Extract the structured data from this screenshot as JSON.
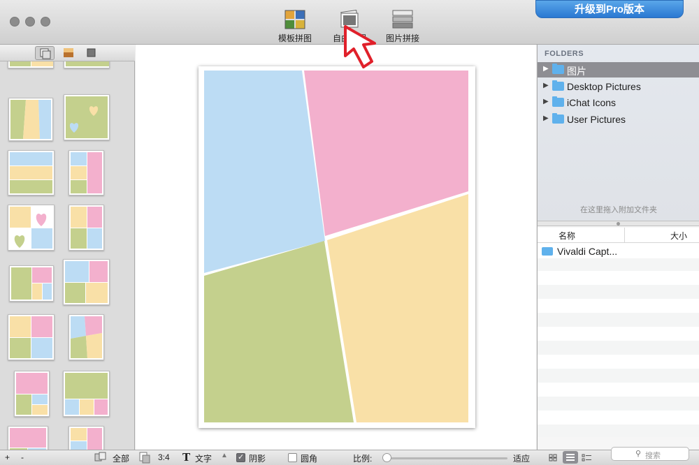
{
  "toolbar": {
    "buttons": [
      {
        "label": "模板拼图",
        "icon": "template-collage-icon"
      },
      {
        "label": "自由拼图",
        "icon": "free-collage-icon"
      },
      {
        "label": "图片拼接",
        "icon": "image-stitch-icon"
      }
    ],
    "upgrade_label": "升级到Pro版本"
  },
  "folders": {
    "header": "FOLDERS",
    "items": [
      {
        "label": "图片",
        "selected": true
      },
      {
        "label": "Desktop Pictures",
        "selected": false
      },
      {
        "label": "iChat Icons",
        "selected": false
      },
      {
        "label": "User Pictures",
        "selected": false
      }
    ],
    "drop_hint": "在这里拖入附加文件夹"
  },
  "file_table": {
    "columns": [
      "名称",
      "大小"
    ],
    "rows": [
      {
        "name": "Vivaldi Capt..."
      }
    ]
  },
  "statusbar": {
    "add": "+",
    "remove": "-",
    "all": "全部",
    "ratio": "3:4",
    "text": "文字",
    "shadow": "阴影",
    "shadow_checked": true,
    "round_corner": "圆角",
    "round_corner_checked": false,
    "scale_label": "比例:",
    "fit": "适应",
    "scale_value": 0.0
  },
  "search": {
    "placeholder": "搜索"
  },
  "colors": {
    "blue": "#bcdcf4",
    "pink": "#f3b0cd",
    "yellow": "#f9e0a7",
    "green": "#c4d08d",
    "accent": "#2a78d2",
    "annotation": "#e0202a"
  }
}
